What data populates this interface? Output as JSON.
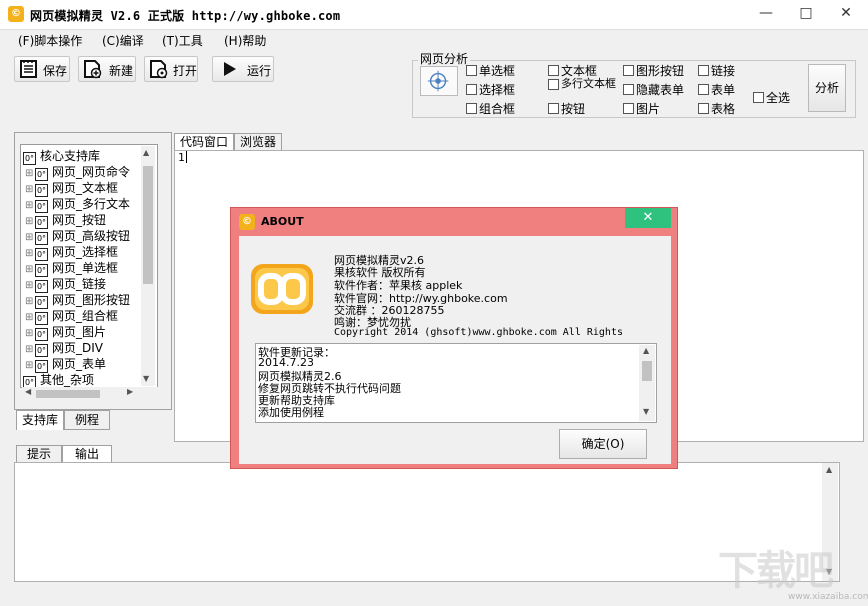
{
  "window": {
    "icon": "©",
    "title": "网页模拟精灵  V2.6 正式版  http://wy.ghboke.com",
    "minimize": "—",
    "maximize": "□",
    "close": "✕"
  },
  "menu": [
    {
      "label": "(F)脚本操作"
    },
    {
      "label": "(C)编译"
    },
    {
      "label": "(T)工具"
    },
    {
      "label": "(H)帮助"
    }
  ],
  "toolbar": {
    "save": "保存",
    "new": "新建",
    "open": "打开",
    "run": "运行"
  },
  "analysis": {
    "legend": "网页分析",
    "checkboxes": [
      "单选框",
      "文本框",
      "图形按钮",
      "链接",
      "选择框",
      "多行文本框",
      "隐藏表单",
      "表单",
      "组合框",
      "按钮",
      "图片",
      "表格"
    ],
    "select_all": "全选",
    "analyze_button": "分析"
  },
  "tree": {
    "root": "核心支持库",
    "items": [
      "网页_网页命令",
      "网页_文本框",
      "网页_多行文本",
      "网页_按钮",
      "网页_高级按钮",
      "网页_选择框",
      "网页_单选框",
      "网页_链接",
      "网页_图形按钮",
      "网页_组合框",
      "网页_图片",
      "网页_DIV",
      "网页_表单"
    ],
    "other": "其他_杂项",
    "node_icon": "0°"
  },
  "left_tabs": [
    "支持库",
    "例程"
  ],
  "editor": {
    "tabs": [
      "代码窗口",
      "浏览器"
    ],
    "line_number": "1"
  },
  "bottom_tabs": [
    "提示",
    "输出"
  ],
  "watermark": {
    "text": "下载吧",
    "url": "www.xiazaiba.com"
  },
  "about": {
    "title": "ABOUT",
    "close": "✕",
    "lines": [
      "网页模拟精灵v2.6",
      "果核软件  版权所有",
      "软件作者：苹果核 applek",
      "软件官网：http://wy.ghboke.com",
      "交流群 ：260128755",
      "鸣谢：梦忧勿扰",
      "Copyright 2014 (ghsoft)www.ghboke.com All Rights"
    ],
    "changelog": [
      "软件更新记录：",
      "2014.7.23",
      "网页模拟精灵2.6",
      "修复网页跳转不执行代码问题",
      "更新帮助支持库",
      "添加使用例程"
    ],
    "ok_button": "确定(O)"
  }
}
